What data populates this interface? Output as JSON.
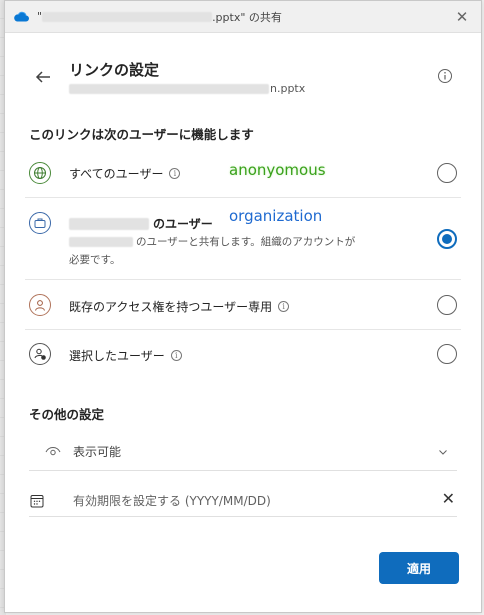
{
  "window": {
    "title_prefix": "\"",
    "title_file_suffix": ".pptx\" の共有",
    "close_glyph": "✕"
  },
  "header": {
    "title": "リンクの設定",
    "file_suffix": "n.pptx"
  },
  "section_who": "このリンクは次のユーザーに機能します",
  "options": [
    {
      "label": "すべてのユーザー",
      "annotation": "anonyomous",
      "selected": false,
      "icon": "globe-icon"
    },
    {
      "label_suffix": "のユーザー",
      "annotation": "organization",
      "description_line1": "のユーザーと共有します。組織のアカウントが",
      "description_line2": "必要です。",
      "selected": true,
      "icon": "briefcase-icon"
    },
    {
      "label": "既存のアクセス権を持つユーザー専用",
      "selected": false,
      "icon": "person-icon"
    },
    {
      "label": "選択したユーザー",
      "selected": false,
      "icon": "people-settings-icon"
    }
  ],
  "section_other": "その他の設定",
  "permission": {
    "value": "表示可能",
    "icon": "eye-icon"
  },
  "expiry": {
    "placeholder": "有効期限を設定する (YYYY/MM/DD)",
    "clear_glyph": "✕",
    "icon": "calendar-icon"
  },
  "apply_label": "適用",
  "colors": {
    "accent": "#0f6cbd",
    "annot_green": "#3aa11c",
    "annot_blue": "#1f6ad0"
  }
}
